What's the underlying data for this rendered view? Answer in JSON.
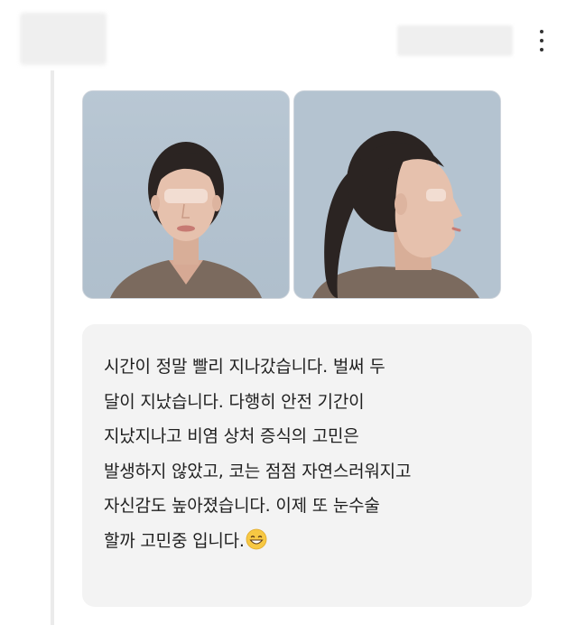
{
  "post": {
    "comment_lines": [
      "시간이 정말 빨리 지나갔습니다. 벌써 두",
      "달이 지났습니다. 다행히 안전 기간이",
      "지났지나고 비염 상처 증식의 고민은",
      "발생하지 않았고, 코는 점점 자연스러워지고",
      "자신감도 높아졌습니다. 이제 또 눈수술",
      "할까 고민중 입니다."
    ],
    "emoji": "grinning-face-with-smiling-eyes"
  },
  "icons": {
    "more": "vertical-ellipsis-icon"
  },
  "colors": {
    "photo_background": "#b3c2cf",
    "bubble_background": "#f3f3f3",
    "text": "#1f1f1f",
    "thread_line": "#ebebeb"
  }
}
